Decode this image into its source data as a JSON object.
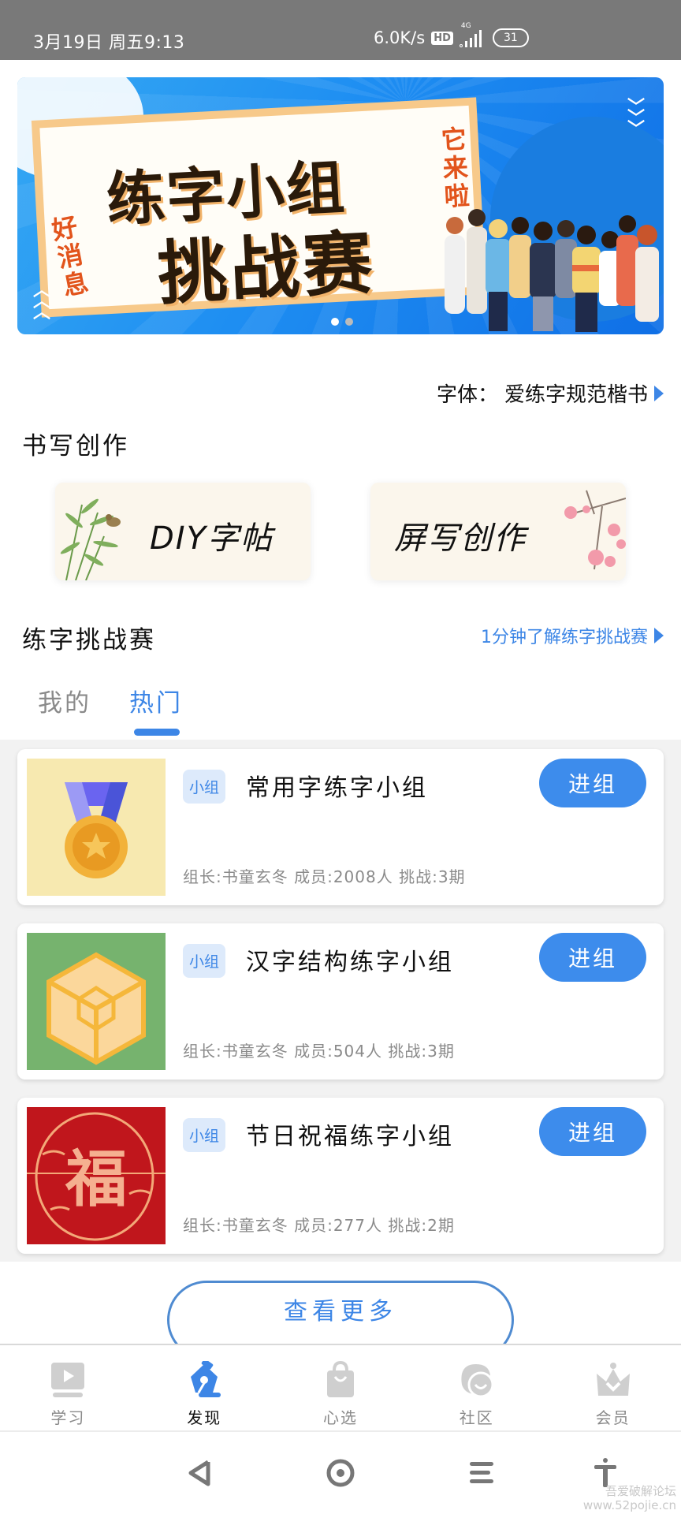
{
  "status_bar": {
    "datetime": "3月19日 周五9:13",
    "network_speed": "6.0K/s",
    "hd_label": "HD",
    "network_type": "4G",
    "battery": "31"
  },
  "banner": {
    "title_line1": "练字小组",
    "title_line2": "挑战赛",
    "tag_left": "好消息",
    "tag_right": "它来啦",
    "slide_count": 2,
    "active_slide": 1
  },
  "font_selector": {
    "label": "字体：",
    "value": "爱练字规范楷书"
  },
  "writing_section": {
    "title": "书写创作",
    "tiles": [
      {
        "label": "DIY字帖"
      },
      {
        "label": "屏写创作"
      }
    ]
  },
  "challenge_section": {
    "title": "练字挑战赛",
    "intro_link": "1分钟了解练字挑战赛",
    "tabs": [
      {
        "label": "我的",
        "active": false
      },
      {
        "label": "热门",
        "active": true
      }
    ],
    "groups": [
      {
        "badge": "小组",
        "name": "常用字练字小组",
        "meta": "组长:书童玄冬  成员:2008人  挑战:3期",
        "join_label": "进组",
        "thumb": "medal-icon"
      },
      {
        "badge": "小组",
        "name": "汉字结构练字小组",
        "meta": "组长:书童玄冬  成员:504人  挑战:3期",
        "join_label": "进组",
        "thumb": "cube-icon"
      },
      {
        "badge": "小组",
        "name": "节日祝福练字小组",
        "meta": "组长:书童玄冬  成员:277人  挑战:2期",
        "join_label": "进组",
        "thumb": "fu-character-icon"
      }
    ],
    "more_label": "查看更多"
  },
  "bottom_nav": {
    "items": [
      {
        "label": "学习",
        "icon": "video-play-icon",
        "active": false
      },
      {
        "label": "发现",
        "icon": "pen-nib-icon",
        "active": true
      },
      {
        "label": "心选",
        "icon": "shopping-bag-icon",
        "active": false
      },
      {
        "label": "社区",
        "icon": "chat-bubbles-icon",
        "active": false
      },
      {
        "label": "会员",
        "icon": "crown-icon",
        "active": false
      }
    ]
  },
  "watermark": {
    "line1": "吾爱破解论坛",
    "line2": "www.52pojie.cn"
  },
  "colors": {
    "accent": "#3d86e6",
    "join_button": "#3d8cec",
    "badge_bg": "#ddeafb",
    "status_bar": "#797979",
    "muted_text": "#8a8a8a",
    "list_bg": "#f2f2f2"
  }
}
